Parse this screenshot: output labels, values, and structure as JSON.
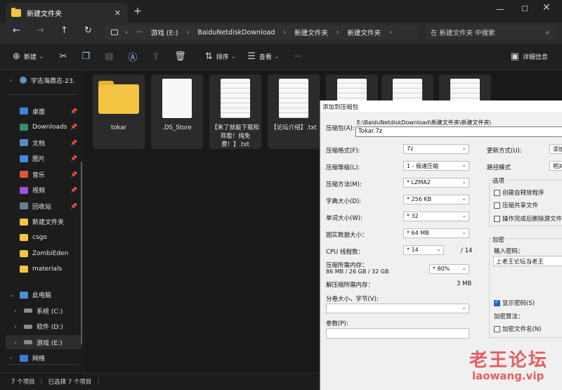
{
  "window": {
    "tab_title": "新建文件夹",
    "tab_close": "✕",
    "new_tab": "+",
    "min": "—",
    "max": "☐",
    "close": "✕"
  },
  "nav": {
    "back": "←",
    "forward": "→",
    "up": "↑",
    "refresh": "↻",
    "more": "···",
    "breadcrumb": [
      "游戏 (E:)",
      "BaiduNetdiskDownload",
      "新建文件夹",
      "新建文件夹"
    ],
    "search_placeholder": "在 新建文件夹 中搜索"
  },
  "toolbar": {
    "new_label": "新建",
    "sort_label": "排序",
    "view_label": "查看",
    "more": "···",
    "details_label": "详细信息"
  },
  "sidebar": {
    "top_item": "宇志海鼎志-23.",
    "quick": [
      {
        "label": "桌面",
        "color": "#3f83d9"
      },
      {
        "label": "Downloads",
        "color": "#2f8f6f"
      },
      {
        "label": "文档",
        "color": "#5a88c9"
      },
      {
        "label": "图片",
        "color": "#3d8be0"
      },
      {
        "label": "音乐",
        "color": "#e0533d"
      },
      {
        "label": "视频",
        "color": "#9a53d9"
      },
      {
        "label": "回收站",
        "color": "#6d7c8c"
      }
    ],
    "folders": [
      "新建文件夹",
      "csgo",
      "ZombiEden",
      "materials"
    ],
    "this_pc": "此电脑",
    "drives": [
      "系统 (C:)",
      "软件 (D:)",
      "游戏 (E:)"
    ],
    "network": "网络"
  },
  "files": [
    {
      "name": "tokar",
      "type": "folder"
    },
    {
      "name": ".DS_Store",
      "type": "blank"
    },
    {
      "name": "【来了就能下载和观看！纯免费！】.txt",
      "type": "text"
    },
    {
      "name": "【论坛介绍】.txt",
      "type": "text"
    },
    {
      "name": "",
      "type": "text"
    },
    {
      "name": "",
      "type": "text"
    },
    {
      "name": "",
      "type": "text"
    }
  ],
  "status": {
    "count": "7 个项目",
    "selected": "已选择 7 个项目"
  },
  "dialog": {
    "title": "添加到压缩包",
    "archive_label": "压缩包(A):",
    "archive_path": "E:\\BaiduNetdiskDownload\\新建文件夹\\新建文件夹\\",
    "archive_name": "Tokar.7z",
    "format_label": "压缩格式(F):",
    "format_value": "7z",
    "level_label": "压缩等级(L):",
    "level_value": "1 - 极速压缩",
    "method_label": "压缩方法(M):",
    "method_value": "* LZMA2",
    "dict_label": "字典大小(D):",
    "dict_value": "* 256 KB",
    "word_label": "单词大小(W):",
    "word_value": "* 32",
    "solid_label": "固实数据大小：",
    "solid_value": "* 64 MB",
    "threads_label": "CPU 线程数：",
    "threads_value": "* 14",
    "threads_max": "/ 14",
    "mem_comp_label": "压缩所需内存：",
    "mem_comp_value": "86 MB / 26 GB / 32 GB",
    "mem_pct": "* 80%",
    "mem_decomp_label": "解压缩所需内存：",
    "mem_decomp_value": "3 MB",
    "split_label": "分卷大小，字节(V):",
    "params_label": "参数(P):",
    "update_label": "更新方式(U):",
    "update_value": "添加",
    "path_label": "路径模式",
    "path_value": "相对",
    "options_label": "选项",
    "opt_sfx": "创建自释放程序",
    "opt_shared": "压缩共享文件",
    "opt_delete": "操作完成后删除源文件",
    "encrypt_label": "加密",
    "pwd_label": "输入密码：",
    "pwd_value": "上老王论坛当老王",
    "show_pwd": "显示密码(S)",
    "enc_method_label": "加密算法：",
    "enc_names": "加密文件名(N)"
  },
  "watermark": {
    "cn": "老王论坛",
    "en": "laowang.vip"
  }
}
